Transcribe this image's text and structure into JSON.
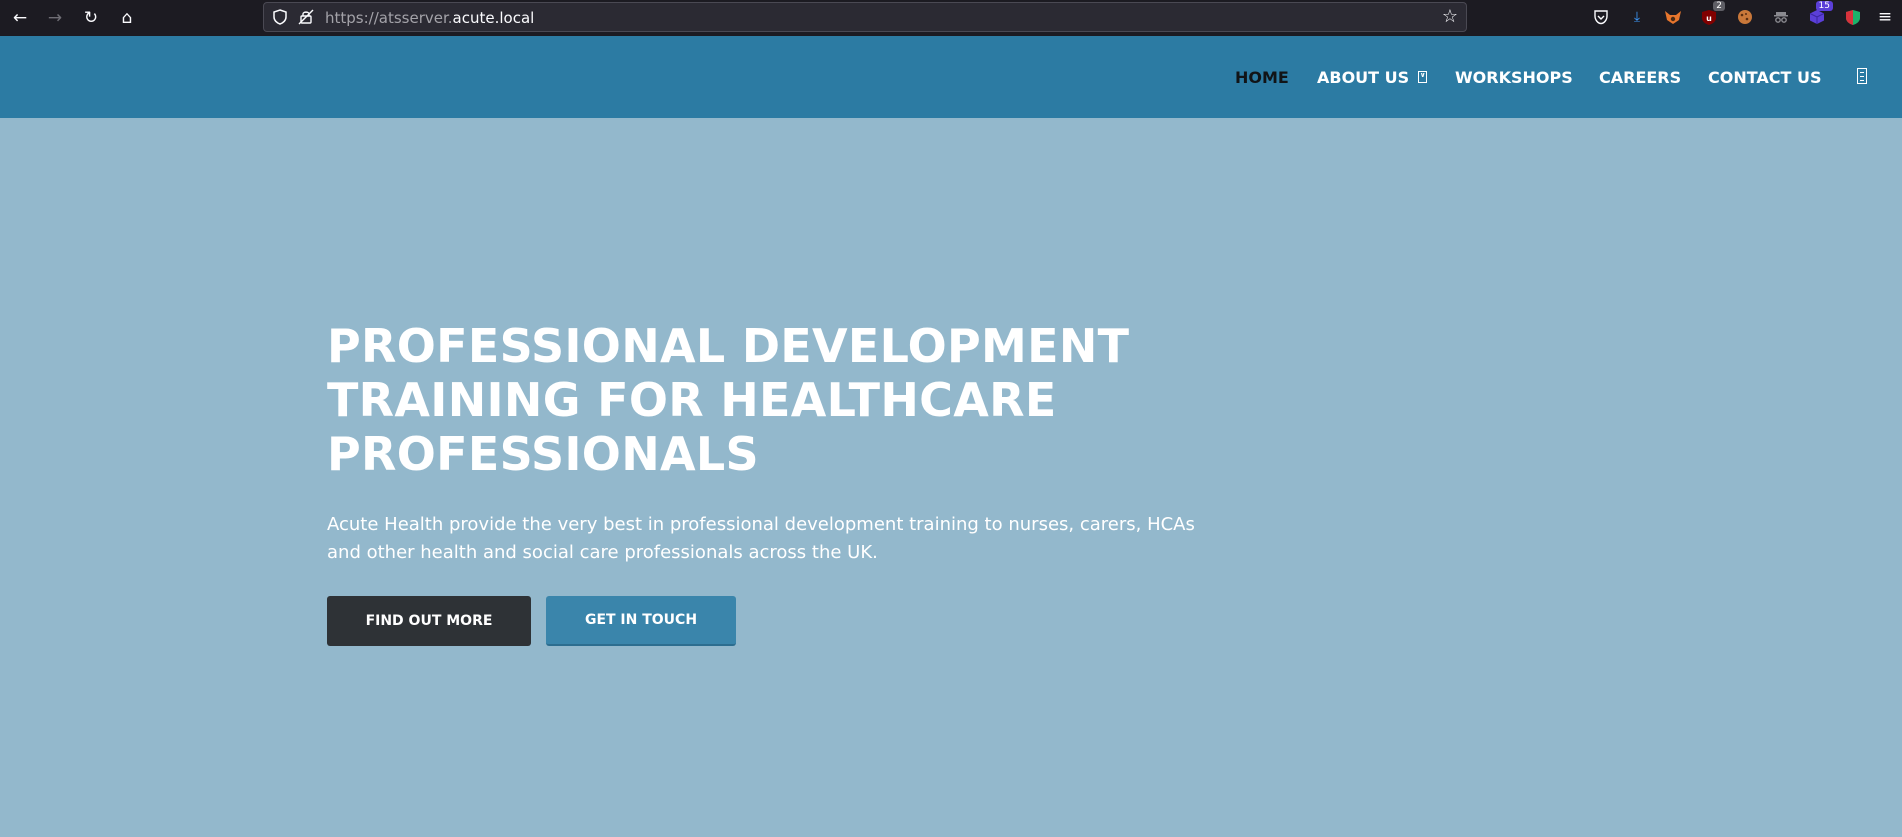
{
  "browser": {
    "url_prefix": "https://atsserver.",
    "url_host": "acute.local",
    "back_icon": "arrow-left-icon",
    "forward_icon": "arrow-right-icon",
    "reload_icon": "reload-icon",
    "home_icon": "home-icon",
    "extensions": [
      {
        "name": "pocket-icon"
      },
      {
        "name": "download-icon"
      },
      {
        "name": "foxyproxy-icon"
      },
      {
        "name": "ublock-icon",
        "badge": "2"
      },
      {
        "name": "cookie-icon"
      },
      {
        "name": "spy-icon"
      },
      {
        "name": "cube-extension-icon",
        "badge": "15"
      },
      {
        "name": "shield-extension-icon"
      },
      {
        "name": "hamburger-menu-icon"
      }
    ]
  },
  "nav": {
    "items": [
      {
        "label": "HOME",
        "active": true
      },
      {
        "label": "ABOUT US",
        "has_dropdown": true
      },
      {
        "label": "WORKSHOPS"
      },
      {
        "label": "CAREERS"
      },
      {
        "label": "CONTACT US"
      }
    ]
  },
  "hero": {
    "title": "PROFESSIONAL DEVELOPMENT TRAINING FOR HEALTHCARE PROFESSIONALS",
    "subtitle": "Acute Health provide the very best in professional development training to nurses, carers, HCAs and other health and social care professionals across the UK.",
    "primary_button": "FIND OUT MORE",
    "secondary_button": "GET IN TOUCH"
  },
  "colors": {
    "header": "#2c7ba3",
    "hero_bg": "#93b8cc",
    "dark_button": "#2e3236",
    "blue_button": "#3a85ab"
  }
}
